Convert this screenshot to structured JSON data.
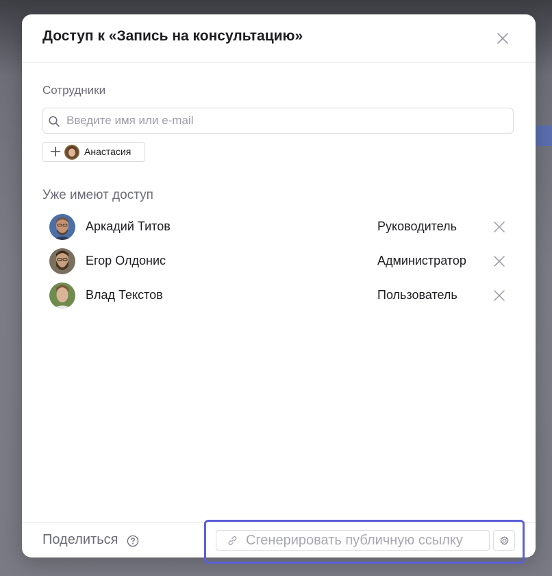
{
  "dialog": {
    "title": "Доступ к «Запись на консультацию»"
  },
  "employees": {
    "label": "Сотрудники",
    "search_placeholder": "Введите имя или e-mail",
    "suggestion": {
      "name": "Анастасия"
    }
  },
  "access": {
    "heading": "Уже имеют доступ",
    "members": [
      {
        "name": "Аркадий Титов",
        "role": "Руководитель"
      },
      {
        "name": "Егор Олдонис",
        "role": "Администратор"
      },
      {
        "name": "Влад Текстов",
        "role": "Пользователь"
      }
    ]
  },
  "footer": {
    "share_label": "Поделиться",
    "generate_label": "Сгенерировать публичную ссылку"
  },
  "colors": {
    "accent_highlight": "#5b5fd8",
    "text_primary": "#1d1d22",
    "text_secondary": "#6c6c78"
  },
  "icons": [
    "close-icon",
    "search-icon",
    "plus-icon",
    "remove-icon",
    "help-icon",
    "link-icon",
    "gear-icon"
  ]
}
